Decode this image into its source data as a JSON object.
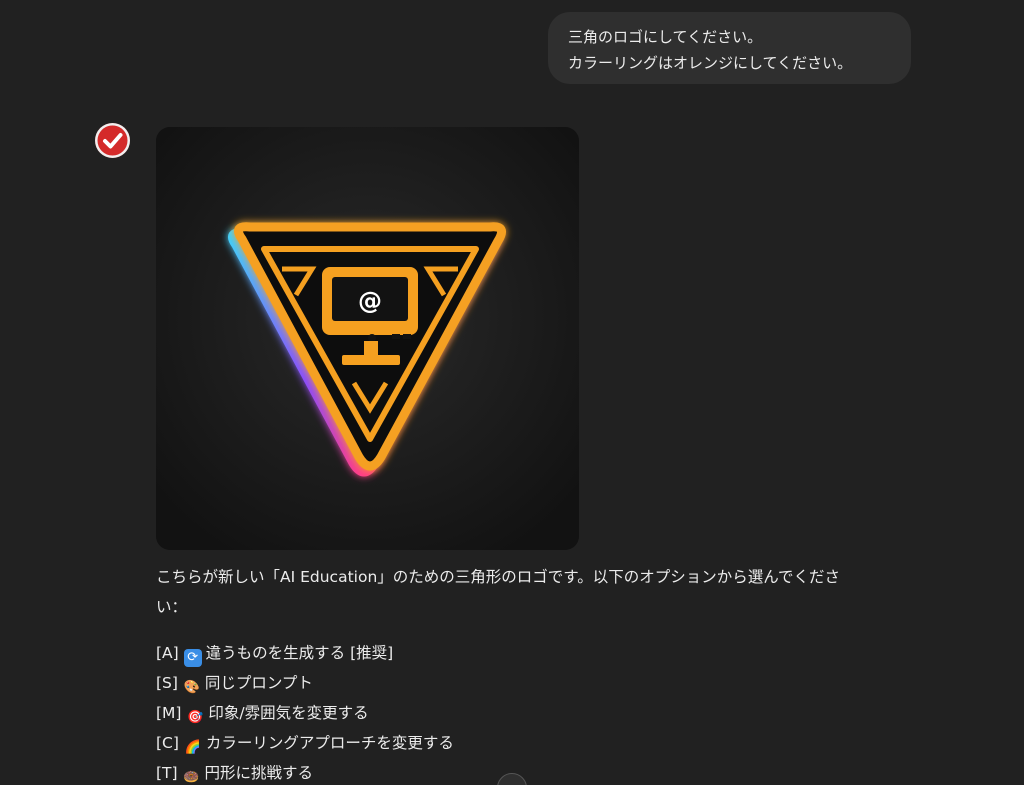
{
  "user_message": {
    "lines": [
      "三角のロゴにしてください。",
      "カラーリングはオレンジにしてください。"
    ]
  },
  "assistant": {
    "avatar_icon": "checkmark-badge-icon",
    "generated_image": {
      "logo_symbol": "@",
      "colors": {
        "orange": "#f5a020",
        "cyan": "#3fd0ff",
        "pink": "#ff3c8a",
        "purple": "#8a4cff",
        "background": "#141414"
      }
    },
    "intro_line1": "こちらが新しい「AI Education」のための三角形のロゴです。以下のオプションから選んでくださ",
    "intro_line2": "い：",
    "options": [
      {
        "key": "[A]",
        "icon": "refresh-icon",
        "label": "違うものを生成する [推奨]"
      },
      {
        "key": "[S]",
        "icon": "palette-icon",
        "label": "同じプロンプト"
      },
      {
        "key": "[M]",
        "icon": "target-icon",
        "label": "印象/雰囲気を変更する"
      },
      {
        "key": "[C]",
        "icon": "rainbow-icon",
        "label": "カラーリングアプローチを変更する"
      },
      {
        "key": "[T]",
        "icon": "donut-icon",
        "label": "円形に挑戦する"
      }
    ]
  }
}
